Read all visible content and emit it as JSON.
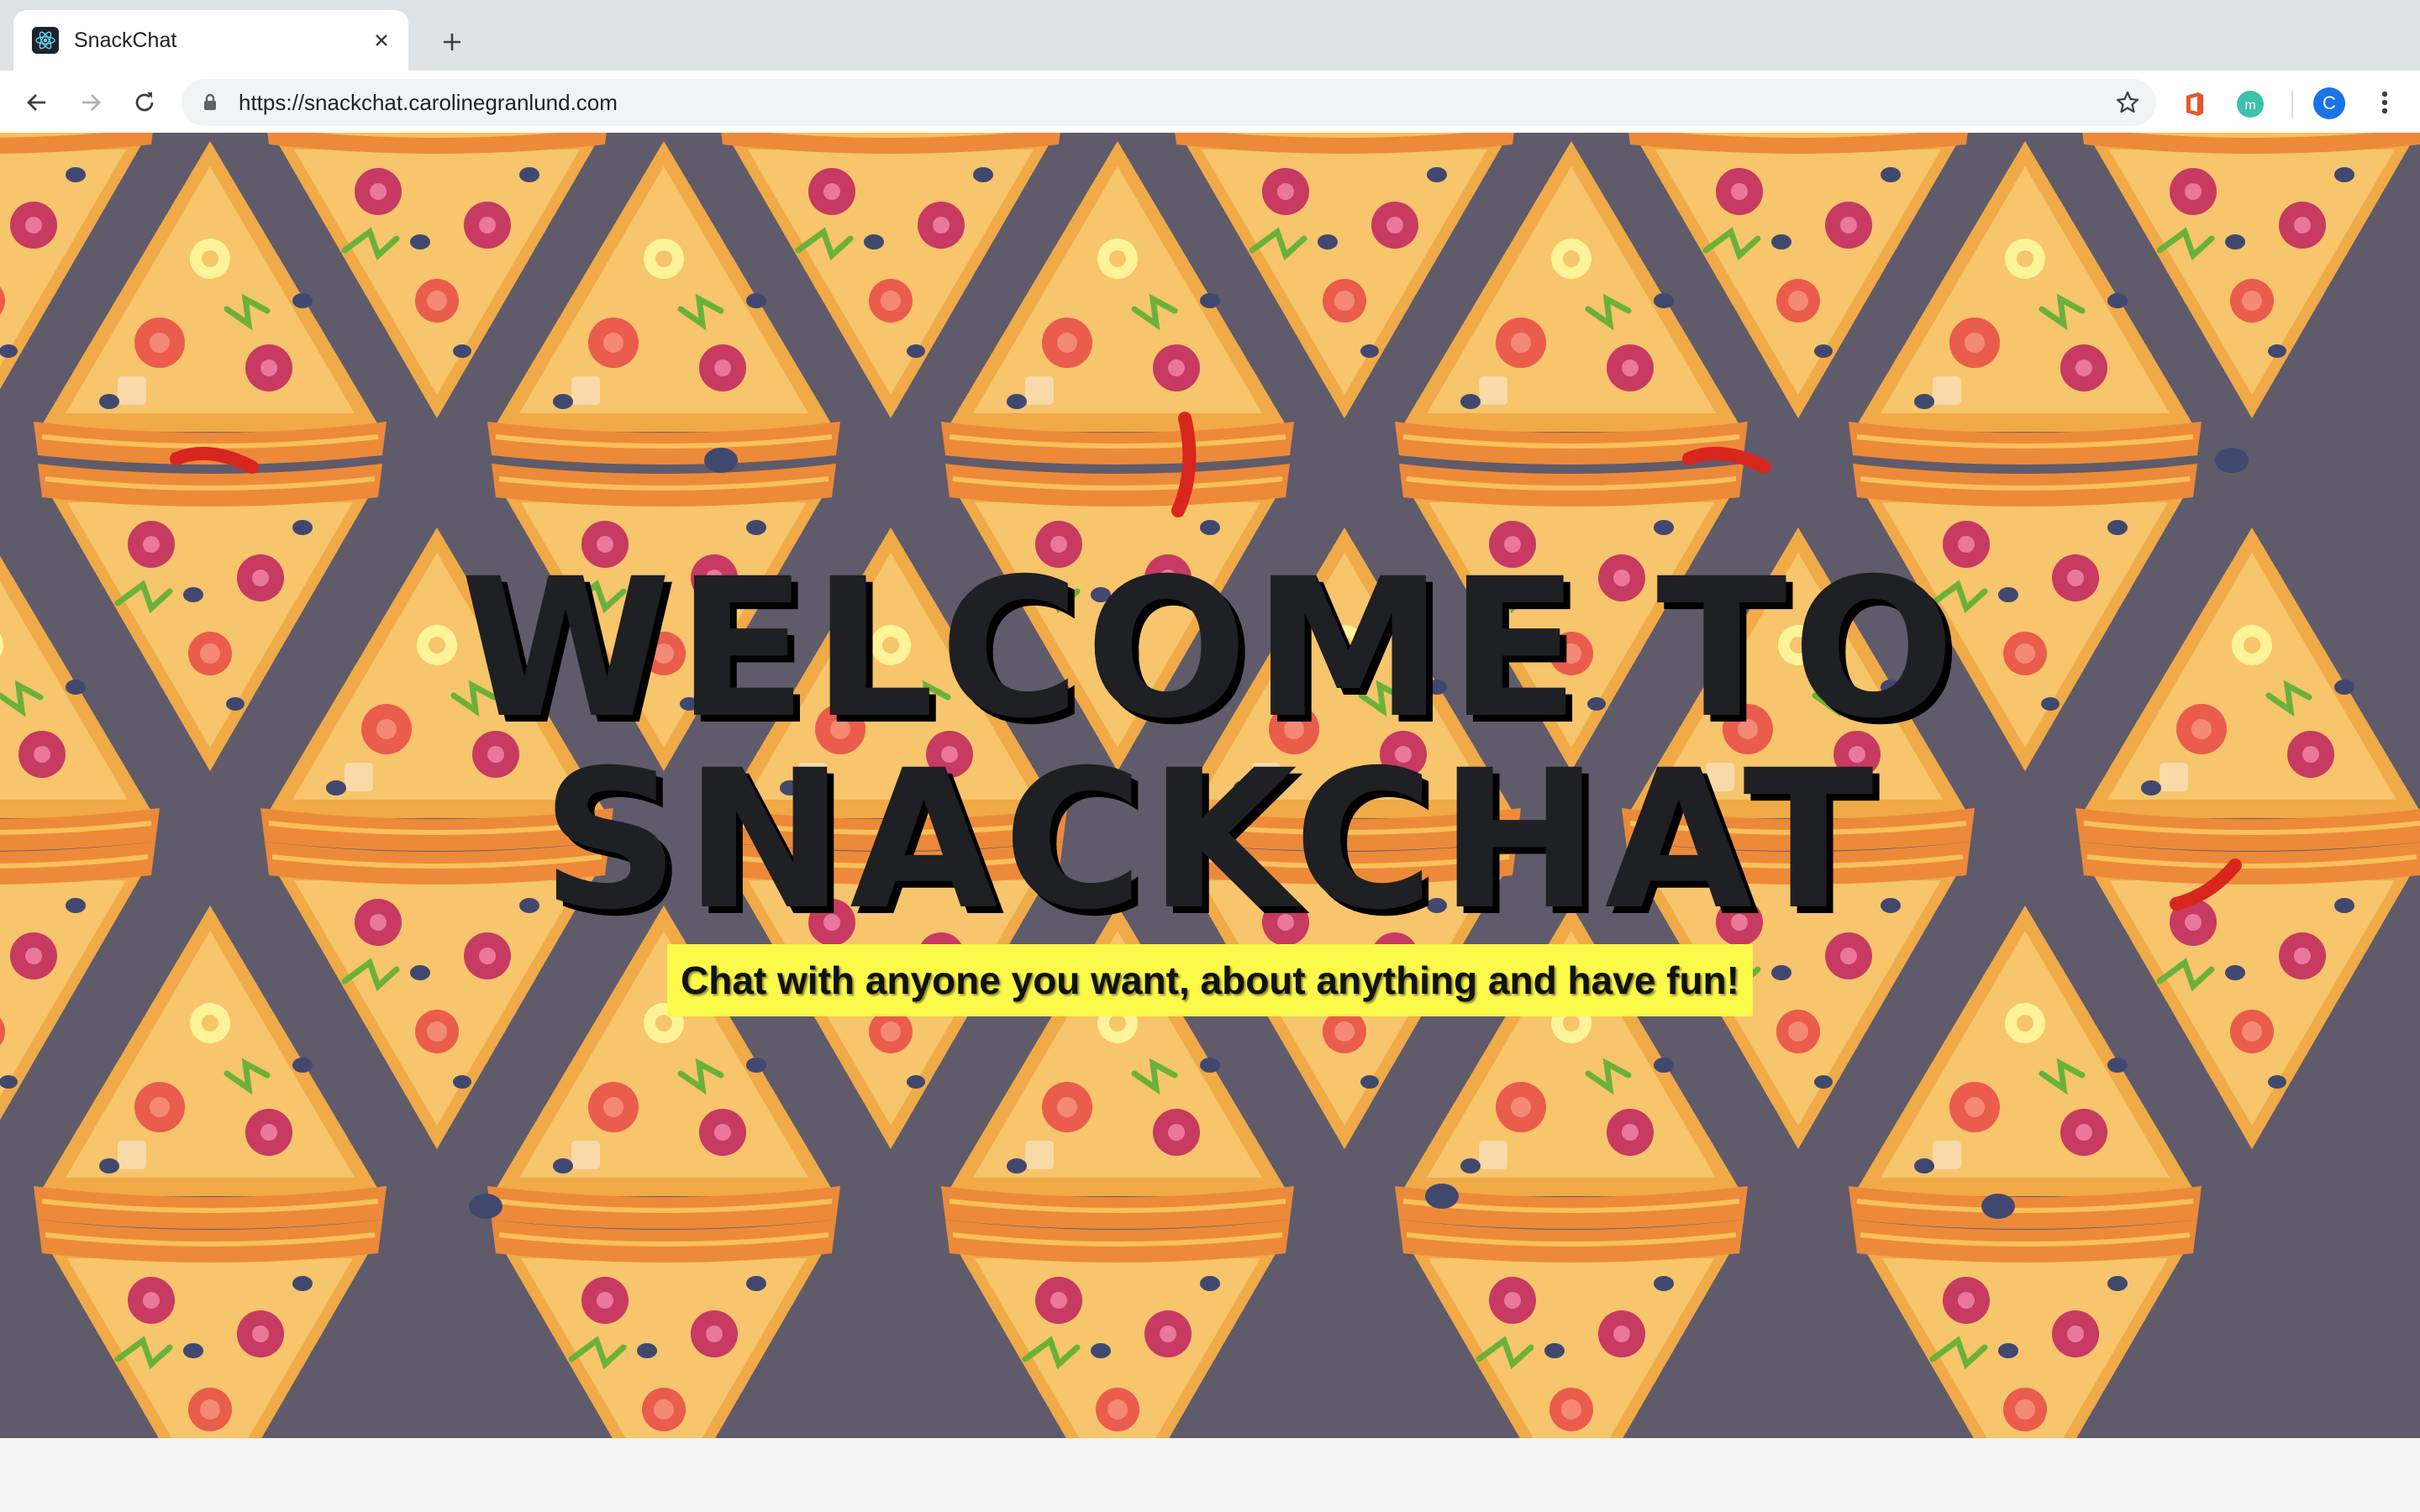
{
  "browser": {
    "tab_title": "SnackChat",
    "url": "https://snackchat.carolinegranlund.com",
    "profile_initial": "C"
  },
  "hero": {
    "title_line1": "WELCOME TO",
    "title_line2": "SNACKCHAT",
    "tagline": "Chat with anyone you want, about anything and have fun!"
  },
  "colors": {
    "background": "#5f5b6b",
    "crust": "#ef9a3f",
    "cheese": "#f4c068",
    "tagline_highlight": "#fbf94a",
    "title_text": "#1f2024"
  },
  "icons": {
    "favicon": "react-atom-icon",
    "pattern": "pizza-slice-pattern"
  }
}
